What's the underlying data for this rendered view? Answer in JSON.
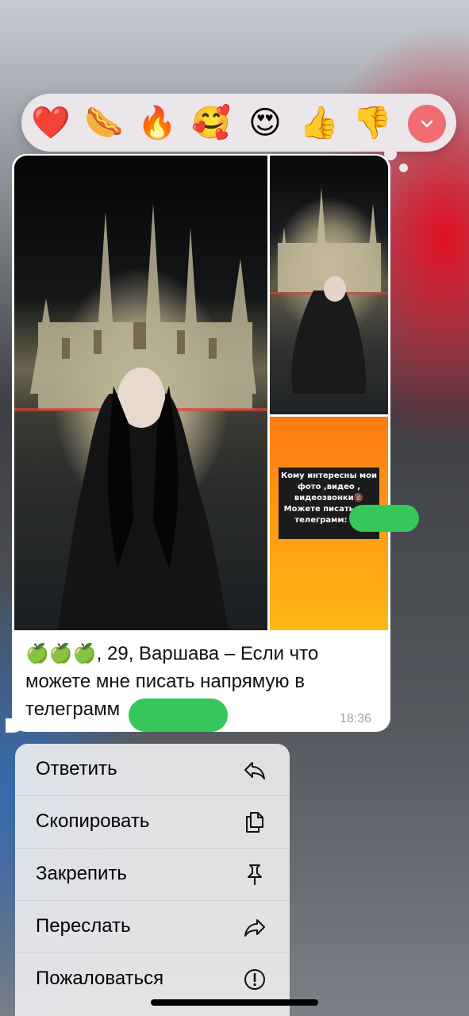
{
  "reactions": [
    "❤️",
    "🌭",
    "🔥",
    "🥰",
    "😍",
    "👍",
    "👎"
  ],
  "message": {
    "emoji": "🍏🍏🍏",
    "caption": ", 29, Варшава – Если что можете мне писать напрямую в телеграмм",
    "time": "18:36",
    "story_text": "Кому интересны мои фото ,видео , видеозвонки🔞 Можете писать мне телеграмм: @k"
  },
  "menu": {
    "reply": "Ответить",
    "copy": "Скопировать",
    "pin": "Закрепить",
    "forward": "Переслать",
    "report": "Пожаловаться"
  },
  "colors": {
    "more_button": "#f06d73",
    "redaction": "#35c759",
    "orange_story": "#ff9a18"
  }
}
